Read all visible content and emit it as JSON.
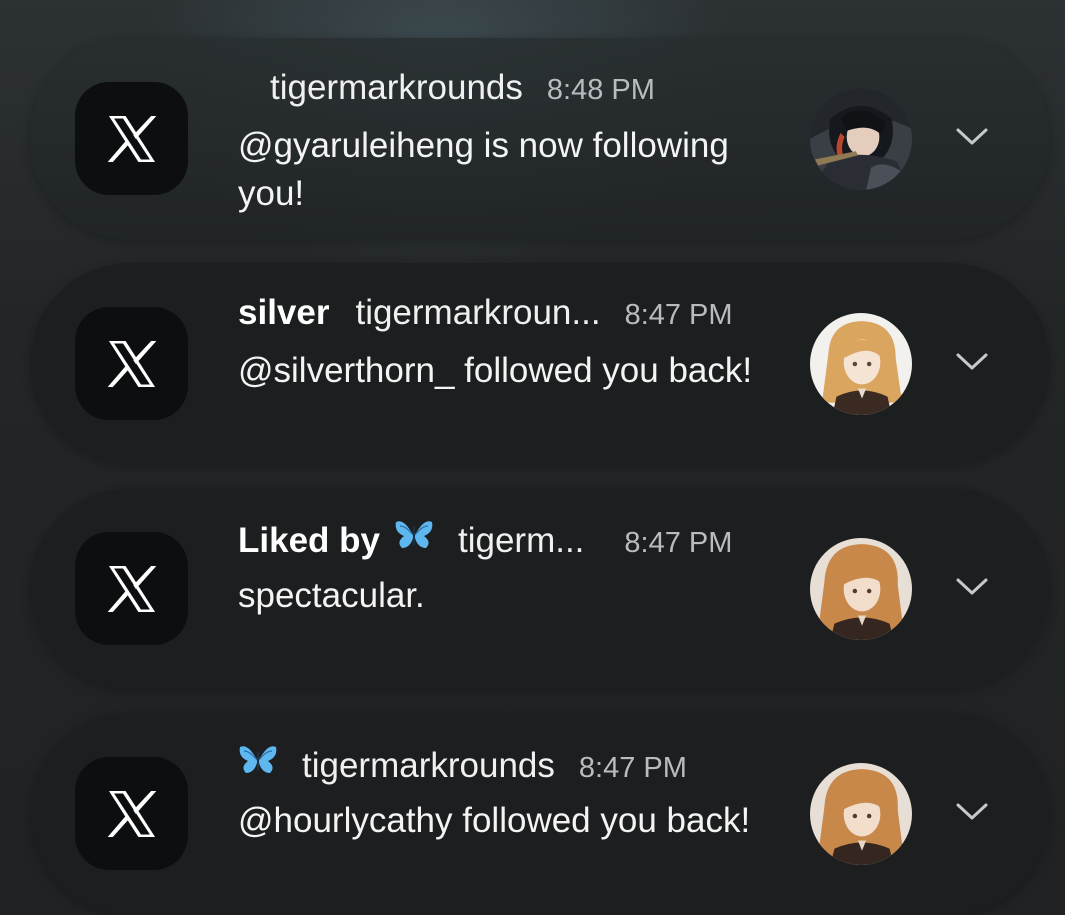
{
  "notifications": [
    {
      "app_icon": "x-logo-icon",
      "title": "",
      "has_butterfly": false,
      "sender": "tigermarkrounds",
      "time": "8:48 PM",
      "message": "@gyaruleiheng is now following you!",
      "avatar": "dark-haired-anime-avatar",
      "expand_icon": "chevron-down-icon"
    },
    {
      "app_icon": "x-logo-icon",
      "title": "silver",
      "has_butterfly": false,
      "sender": "tigermarkroun...",
      "time": "8:47 PM",
      "message": "@silverthorn_ followed you back!",
      "avatar": "blonde-anime-avatar",
      "expand_icon": "chevron-down-icon"
    },
    {
      "app_icon": "x-logo-icon",
      "title": "Liked by",
      "has_butterfly": true,
      "sender": "tigerm...",
      "time": "8:47 PM",
      "message": "spectacular.",
      "avatar": "blonde-anime-avatar",
      "expand_icon": "chevron-down-icon"
    },
    {
      "app_icon": "x-logo-icon",
      "title": "",
      "has_butterfly": true,
      "sender": "tigermarkrounds",
      "time": "8:47 PM",
      "message": "@hourlycathy followed you back!",
      "avatar": "blonde-anime-avatar",
      "expand_icon": "chevron-down-icon"
    }
  ],
  "colors": {
    "butterfly": "#5fb7f0",
    "card_background": "#1c1e1f",
    "time_text": "#b8bcbf"
  }
}
